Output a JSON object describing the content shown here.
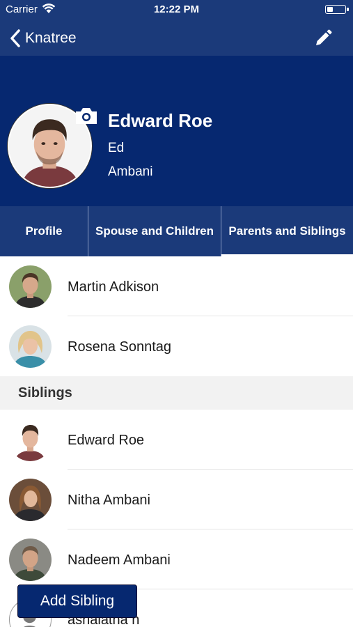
{
  "status_bar": {
    "carrier": "Carrier",
    "time": "12:22 PM",
    "battery_level": 0.35
  },
  "nav": {
    "back_label": "Knatree",
    "back_icon": "chevron-left-icon",
    "edit_icon": "pencil-icon"
  },
  "profile": {
    "name": "Edward Roe",
    "nickname": "Ed",
    "surname": "Ambani",
    "camera_icon": "camera-icon"
  },
  "tabs": [
    {
      "label": "Profile",
      "active": false
    },
    {
      "label": "Spouse and Children",
      "active": false
    },
    {
      "label": "Parents and Siblings",
      "active": true
    }
  ],
  "parents": [
    {
      "name": "Martin Adkison"
    },
    {
      "name": "Rosena Sonntag"
    }
  ],
  "siblings_header": "Siblings",
  "siblings": [
    {
      "name": "Edward Roe"
    },
    {
      "name": "Nitha Ambani"
    },
    {
      "name": "Nadeem Ambani"
    },
    {
      "name": "ashalatha h"
    }
  ],
  "add_sibling_label": "Add Sibling",
  "colors": {
    "nav_blue": "#1b3a7a",
    "header_blue": "#062870",
    "section_gray": "#f2f2f2"
  }
}
